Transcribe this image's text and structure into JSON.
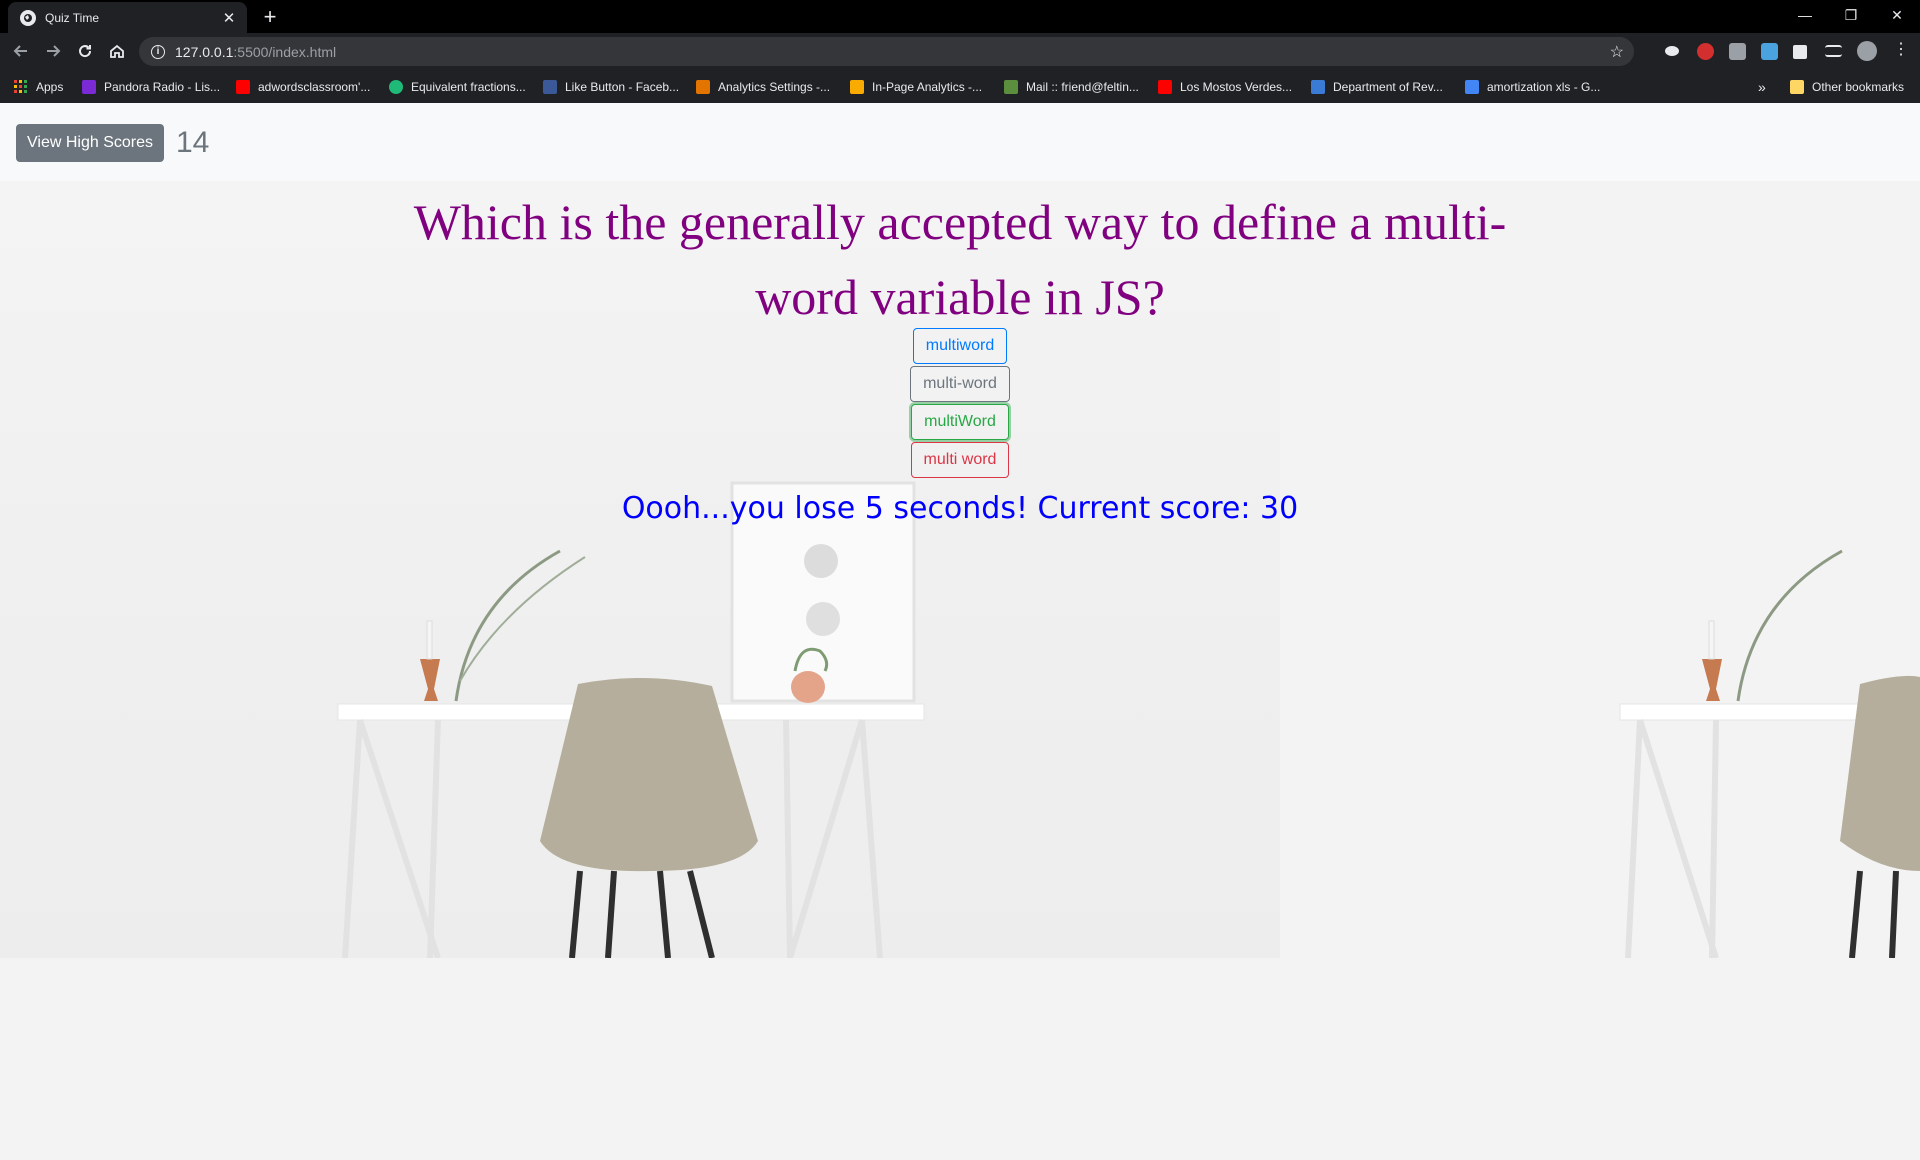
{
  "browser": {
    "tab_title": "Quiz Time",
    "url_host": "127.0.0.1",
    "url_path": ":5500/index.html",
    "bookmarks": [
      {
        "label": "Apps",
        "color": "#ea4335"
      },
      {
        "label": "Pandora Radio - Lis...",
        "color": "#7b2bd6"
      },
      {
        "label": "adwordsclassroom'...",
        "color": "#ff0000"
      },
      {
        "label": "Equivalent fractions...",
        "color": "#1fb978"
      },
      {
        "label": "Like Button - Faceb...",
        "color": "#3b5998"
      },
      {
        "label": "Analytics Settings -...",
        "color": "#e37400"
      },
      {
        "label": "In-Page Analytics -...",
        "color": "#f9ab00"
      },
      {
        "label": "Mail :: friend@feltin...",
        "color": "#5b8f3d"
      },
      {
        "label": "Los Mostos Verdes...",
        "color": "#ff0000"
      },
      {
        "label": "Department of Rev...",
        "color": "#3a7bd5"
      },
      {
        "label": "amortization xls - G...",
        "color": "#4285f4"
      }
    ],
    "other_bookmarks": "Other bookmarks",
    "overflow": "»"
  },
  "navbar": {
    "high_scores_label": "View High Scores",
    "timer": "14"
  },
  "quiz": {
    "question": "Which is the generally accepted way to define a multi-word variable in JS?",
    "answers": [
      "multiword",
      "multi-word",
      "multiWord",
      "multi word"
    ],
    "feedback": "Oooh...you lose 5 seconds! Current score: 30"
  },
  "colors": {
    "question": "#800080",
    "feedback": "#0000ff",
    "high_scores_button": "#6c757d"
  }
}
